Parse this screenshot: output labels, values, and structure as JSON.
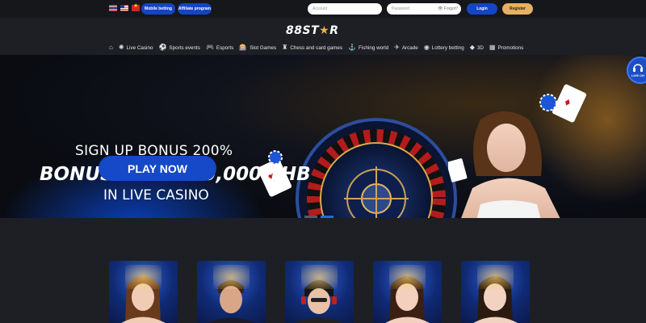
{
  "topbar": {
    "flags": [
      "thailand-flag",
      "usa-flag",
      "vietnam-flag"
    ],
    "mobile_betting": "Mobile betting",
    "affiliate_program": "Affiliate program",
    "account_placeholder": "Account",
    "password_placeholder": "Password",
    "forgot": "Forgot?",
    "login": "Login",
    "register": "Register"
  },
  "logo": {
    "text": "88ST",
    "star": "★",
    "suffix": "R"
  },
  "nav": {
    "items": [
      {
        "icon": "home-icon",
        "glyph": "⌂",
        "label": ""
      },
      {
        "icon": "live-casino-icon",
        "glyph": "✺",
        "label": "Live Casino"
      },
      {
        "icon": "sports-icon",
        "glyph": "⚽",
        "label": "Sports events"
      },
      {
        "icon": "esports-icon",
        "glyph": "🎮",
        "label": "Esports"
      },
      {
        "icon": "slot-games-icon",
        "glyph": "🎰",
        "label": "Slot Games"
      },
      {
        "icon": "chess-icon",
        "glyph": "♜",
        "label": "Chess and card games"
      },
      {
        "icon": "fishing-icon",
        "glyph": "⚓",
        "label": "Fishing world"
      },
      {
        "icon": "arcade-icon",
        "glyph": "✈",
        "label": "Arcade"
      },
      {
        "icon": "lottery-icon",
        "glyph": "◉",
        "label": "Lottery betting"
      },
      {
        "icon": "3d-icon",
        "glyph": "◆",
        "label": "3D"
      },
      {
        "icon": "promotions-icon",
        "glyph": "▦",
        "label": "Promotions"
      }
    ]
  },
  "banner": {
    "line1": "SIGN UP BONUS 200%",
    "line2": "BONUS UP TO  20,000 THB",
    "line3": "IN LIVE CASINO",
    "cta": "PLAY NOW",
    "slide_count": 2,
    "active_slide": 2
  },
  "support": {
    "label": "LIVE CH"
  },
  "games": {
    "count": 5
  },
  "colors": {
    "accent_blue": "#1545c4",
    "gold": "#e6b163",
    "bg": "#1d1f24"
  }
}
